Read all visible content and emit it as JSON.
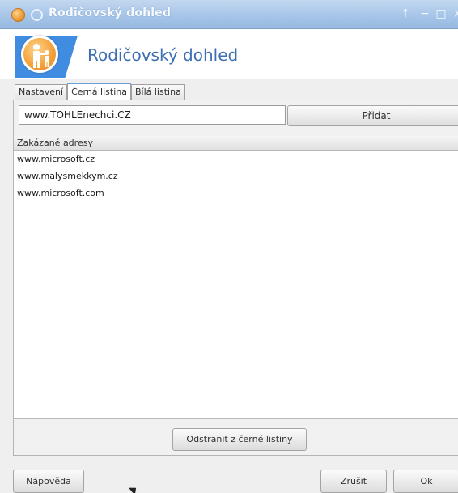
{
  "window": {
    "title": "Rodičovský dohled",
    "title_buttons": [
      "↑",
      "−",
      "□",
      "×"
    ]
  },
  "header": {
    "title": "Rodičovský dohled",
    "logo_icon": "parental-control-icon",
    "accent_color": "#3f8ce0"
  },
  "tabs": [
    {
      "label": "Nastavení",
      "active": false
    },
    {
      "label": "Černá listina",
      "active": true
    },
    {
      "label": "Bílá listina",
      "active": false
    }
  ],
  "blacklist": {
    "input_value": "www.TOHLEnechci.CZ",
    "add_label": "Přidat",
    "column_header": "Zakázané adresy",
    "items": [
      "www.microsoft.cz",
      "www.malysmekkym.cz",
      "www.microsoft.com"
    ],
    "remove_label": "Odstranit z černé listiny"
  },
  "footer": {
    "help_label": "Nápověda",
    "cancel_label": "Zrušit",
    "ok_label": "Ok"
  }
}
